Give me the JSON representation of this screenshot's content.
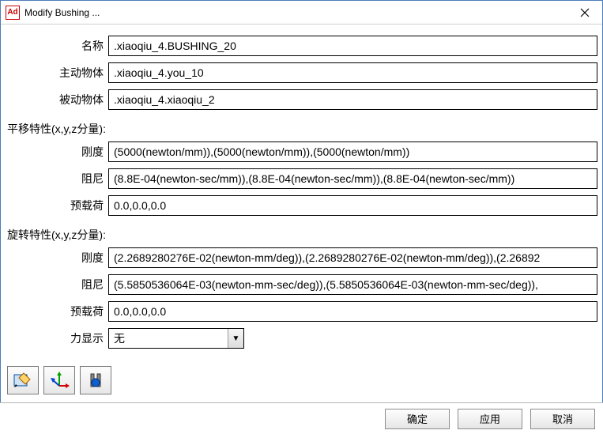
{
  "window": {
    "icon_text": "Ad",
    "title": "Modify Bushing ..."
  },
  "fields": {
    "name_label": "名称",
    "name_value": ".xiaoqiu_4.BUSHING_20",
    "active_label": "主动物体",
    "active_value": ".xiaoqiu_4.you_10",
    "passive_label": "被动物体",
    "passive_value": ".xiaoqiu_4.xiaoqiu_2"
  },
  "translational": {
    "header": "平移特性(x,y,z分量):",
    "stiffness_label": "刚度",
    "stiffness_value": "(5000(newton/mm)),(5000(newton/mm)),(5000(newton/mm))",
    "damping_label": "阻尼",
    "damping_value": "(8.8E-04(newton-sec/mm)),(8.8E-04(newton-sec/mm)),(8.8E-04(newton-sec/mm))",
    "preload_label": "预载荷",
    "preload_value": "0.0,0.0,0.0"
  },
  "rotational": {
    "header": "旋转特性(x,y,z分量):",
    "stiffness_label": "刚度",
    "stiffness_value": "(2.2689280276E-02(newton-mm/deg)),(2.2689280276E-02(newton-mm/deg)),(2.26892",
    "damping_label": "阻尼",
    "damping_value": "(5.5850536064E-03(newton-mm-sec/deg)),(5.5850536064E-03(newton-mm-sec/deg)),",
    "preload_label": "预载荷",
    "preload_value": "0.0,0.0,0.0",
    "force_display_label": "力显示",
    "force_display_value": "无"
  },
  "buttons": {
    "ok": "确定",
    "apply": "应用",
    "cancel": "取消"
  }
}
